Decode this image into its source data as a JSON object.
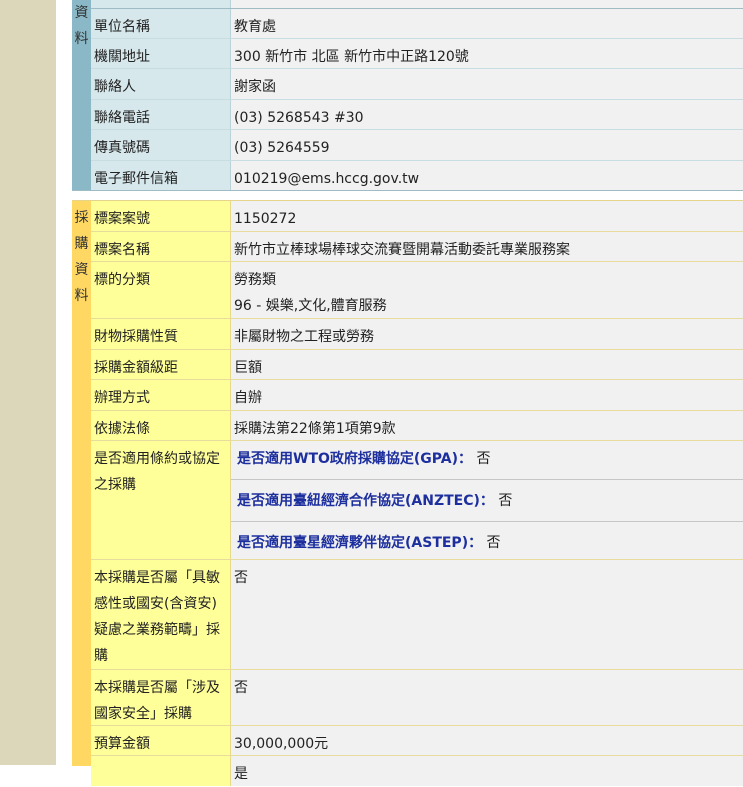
{
  "contact_section": {
    "category": "資料",
    "rows": [
      {
        "label": "單位名稱",
        "value": "教育處"
      },
      {
        "label": "機關地址",
        "value": "300 新竹市 北區 新竹市中正路120號"
      },
      {
        "label": "聯絡人",
        "value": "謝家函"
      },
      {
        "label": "聯絡電話",
        "value": "(03) 5268543 #30"
      },
      {
        "label": "傳真號碼",
        "value": "(03) 5264559"
      },
      {
        "label": "電子郵件信箱",
        "value": "010219@ems.hccg.gov.tw"
      }
    ]
  },
  "procurement_section": {
    "category": "採購資料",
    "case_no": {
      "label": "標案案號",
      "value": "1150272"
    },
    "case_name": {
      "label": "標案名稱",
      "value": "新竹市立棒球場棒球交流賽暨開幕活動委託專業服務案"
    },
    "subject": {
      "label": "標的分類",
      "value_line1": "勞務類",
      "value_line2": "96 - 娛樂,文化,體育服務"
    },
    "nature": {
      "label": "財物採購性質",
      "value": "非屬財物之工程或勞務"
    },
    "amount_tier": {
      "label": "採購金額級距",
      "value": "巨額"
    },
    "method": {
      "label": "辦理方式",
      "value": "自辦"
    },
    "law": {
      "label": "依據法條",
      "value": "採購法第22條第1項第9款"
    },
    "treaty": {
      "label": "是否適用條約或協定之採購",
      "items": [
        {
          "name": "是否適用WTO政府採購協定(GPA)：",
          "value": "否"
        },
        {
          "name": "是否適用臺紐經濟合作協定(ANZTEC)：",
          "value": "否"
        },
        {
          "name": "是否適用臺星經濟夥伴協定(ASTEP)：",
          "value": "否"
        }
      ]
    },
    "sensitive": {
      "label": "本採購是否屬「具敏感性或國安(含資安)疑慮之業務範疇」採購",
      "value": "否"
    },
    "national_security": {
      "label": "本採購是否屬「涉及國家安全」採購",
      "value": "否"
    },
    "budget": {
      "label": "預算金額",
      "value": "30,000,000元"
    },
    "next_value": "是"
  }
}
